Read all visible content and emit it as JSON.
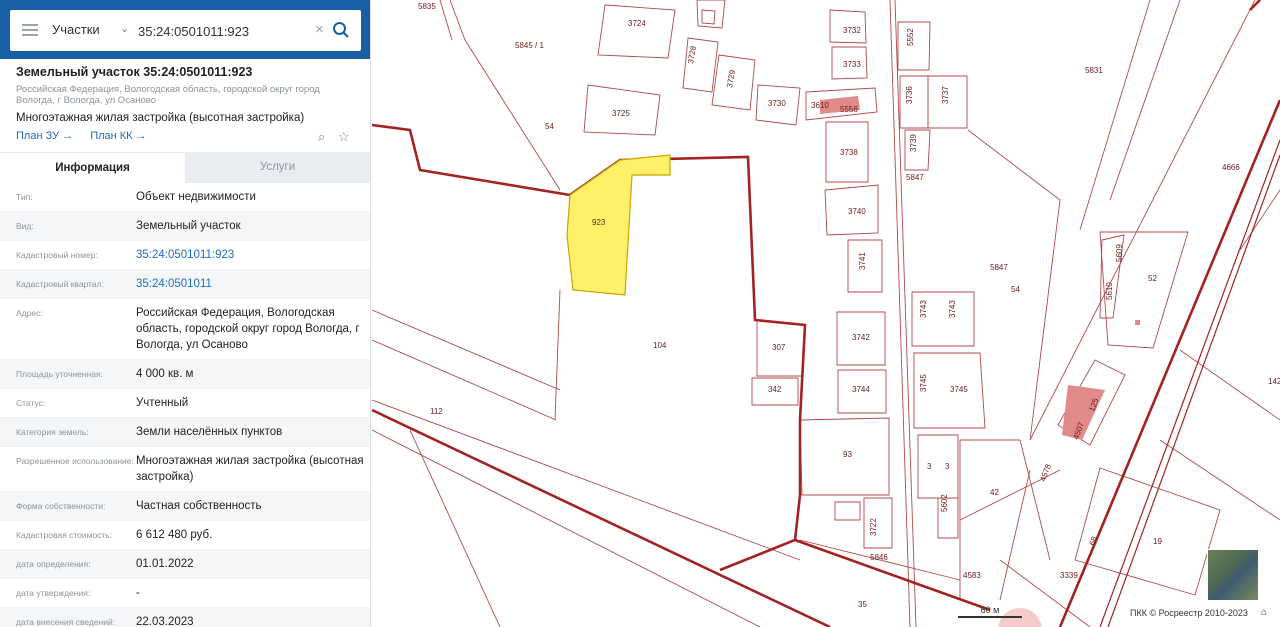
{
  "search": {
    "type_label": "Участки",
    "query": "35:24:0501011:923"
  },
  "object": {
    "title": "Земельный участок 35:24:0501011:923",
    "address": "Российская Федерация, Вологодская область, городской округ город Вологда, г Вологда, ул Осаново",
    "use": "Многоэтажная жилая застройка (высотная застройка)",
    "plan_zu": "План ЗУ →",
    "plan_kk": "План КК →"
  },
  "tabs": {
    "info": "Информация",
    "services": "Услуги"
  },
  "info": [
    {
      "key": "Тип:",
      "value": "Объект недвижимости"
    },
    {
      "key": "Вид:",
      "value": "Земельный участок"
    },
    {
      "key": "Кадастровый номер:",
      "value": "35:24:0501011:923"
    },
    {
      "key": "Кадастровый квартал:",
      "value": "35:24:0501011"
    },
    {
      "key": "Адрес:",
      "value": "Российская Федерация, Вологодская область, городской округ город Вологда, г Вологда, ул Осаново"
    },
    {
      "key": "Площадь уточненная:",
      "value": "4 000 кв. м"
    },
    {
      "key": "Статус:",
      "value": "Учтенный"
    },
    {
      "key": "Категория земель:",
      "value": "Земли населённых пунктов"
    },
    {
      "key": "Разрешенное использование:",
      "value": "Многоэтажная жилая застройка (высотная застройка)"
    },
    {
      "key": "Форма собственности:",
      "value": "Частная собственность"
    },
    {
      "key": "Кадастровая стоимость:",
      "value": "6 612 480 руб."
    },
    {
      "key": "дата определения:",
      "value": "01.01.2022"
    },
    {
      "key": "дата утверждения:",
      "value": "-"
    },
    {
      "key": "дата внесения сведений:",
      "value": "22.03.2023"
    }
  ],
  "map": {
    "labels": [
      "5835",
      "3724",
      "5845 / 1",
      "3728",
      "3729",
      "3725",
      "3730",
      "3610",
      "5556",
      "3732",
      "3733",
      "5552",
      "5831",
      "3736",
      "3737",
      "54",
      "3738",
      "3739",
      "5847",
      "4666",
      "923",
      "3740",
      "3741",
      "5847",
      "54",
      "5609",
      "52",
      "5610",
      "104",
      "3742",
      "3743",
      "3743",
      "307",
      "342",
      "3744",
      "3745",
      "3745",
      "112",
      "93",
      "3",
      "3",
      "42",
      "4578",
      "4507",
      "125",
      "5602",
      "3722",
      "5846",
      "4583",
      "3339",
      "19",
      "35",
      "68",
      "142"
    ],
    "scale_label": "60 м",
    "copyright": "ПКК © Росреестр 2010-2023"
  },
  "colors": {
    "header_bg": "#1760a6",
    "link": "#1a6fbf",
    "parcel_line": "#a83a3a",
    "selected_parcel": "#fff06a"
  }
}
